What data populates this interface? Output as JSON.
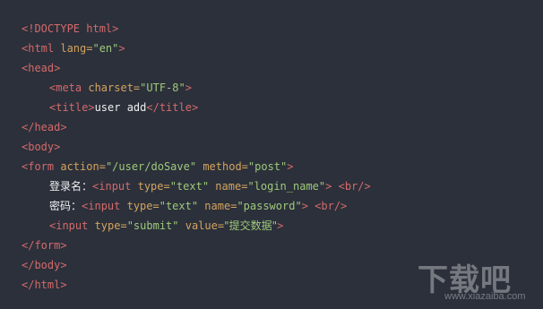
{
  "code": {
    "l1": {
      "doctype": "<!DOCTYPE html>"
    },
    "l2": {
      "open": "<html ",
      "attr": "lang=",
      "val": "\"en\"",
      "close": ">"
    },
    "l3": {
      "tag": "<head>"
    },
    "l4": {
      "open": "<meta ",
      "attr": "charset=",
      "val": "\"UTF-8\"",
      "close": ">"
    },
    "l5": {
      "open": "<title>",
      "text": "user add",
      "close": "</title>"
    },
    "l6": {
      "tag": "</head>"
    },
    "l7": {
      "tag": "<body>"
    },
    "l8": {
      "open": "<form ",
      "attr1": "action=",
      "val1": "\"/user/doSave\"",
      "attr2": " method=",
      "val2": "\"post\"",
      "close": ">"
    },
    "l9": {
      "label": "登录名：",
      "open": "<input ",
      "attr1": "type=",
      "val1": "\"text\"",
      "attr2": " name=",
      "val2": "\"login_name\"",
      "close": ">",
      "br": " <br/>"
    },
    "l10": {
      "label": "密码：",
      "open": "<input ",
      "attr1": "type=",
      "val1": "\"text\"",
      "attr2": " name=",
      "val2": "\"password\"",
      "close": ">",
      "br": " <br/>"
    },
    "l11": {
      "open": "<input ",
      "attr1": "type=",
      "val1": "\"submit\"",
      "attr2": " value=",
      "val2": "\"提交数据\"",
      "close": ">"
    },
    "l12": {
      "tag": "</form>"
    },
    "l13": {
      "tag": "</body>"
    },
    "l14": {
      "tag": "</html>"
    }
  },
  "watermark": {
    "logo": "下载吧",
    "url": "www.xiazaiba.com"
  },
  "colors": {
    "background": "#2b303b",
    "tag": "#d36a6a",
    "attribute": "#d4a35f",
    "string": "#9fc97a",
    "text": "#f0f0f0"
  }
}
